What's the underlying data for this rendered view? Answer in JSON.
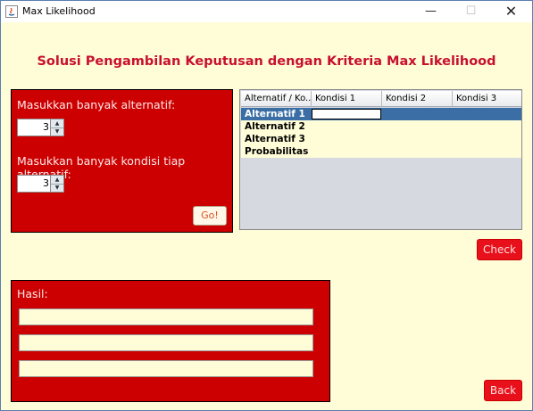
{
  "window": {
    "title": "Max Likelihood",
    "controls": {
      "minimize": "—",
      "maximize": "☐",
      "close": "✕"
    }
  },
  "heading": "Solusi Pengambilan Keputusan dengan Kriteria Max Likelihood",
  "input_panel": {
    "alt_label": "Masukkan banyak alternatif:",
    "alt_value": "3",
    "cond_label": "Masukkan banyak kondisi tiap alternatif:",
    "cond_value": "3",
    "go_label": "Go!"
  },
  "table": {
    "columns": [
      "Alternatif / Ko...",
      "Kondisi 1",
      "Kondisi 2",
      "Kondisi 3"
    ],
    "rows": [
      "Alternatif 1",
      "Alternatif 2",
      "Alternatif 3",
      "Probabilitas"
    ],
    "selected_row": 0
  },
  "check_label": "Check",
  "result_panel": {
    "label": "Hasil:",
    "fields": [
      "",
      "",
      ""
    ]
  },
  "back_label": "Back",
  "colors": {
    "panel_red": "#cc0000",
    "heading_red": "#c8102e",
    "background": "#fffdd8",
    "selection": "#3a6ea5"
  },
  "icons": [
    "java-app-icon",
    "spinner-up-icon",
    "spinner-down-icon"
  ]
}
